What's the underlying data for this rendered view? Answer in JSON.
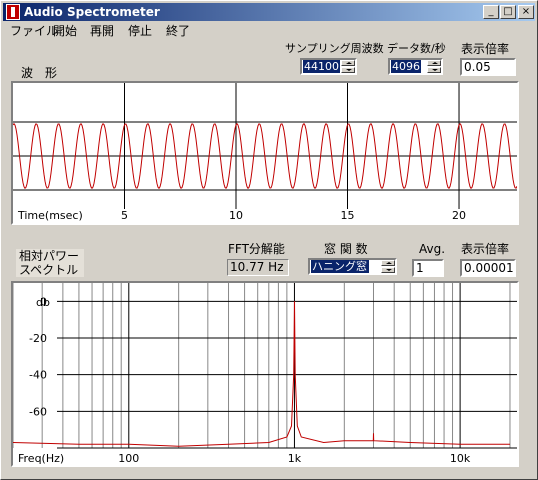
{
  "window": {
    "title": "Audio Spectrometer",
    "min_glyph": "_",
    "max_glyph": "□",
    "close_glyph": "×"
  },
  "menu": [
    "ファイル",
    "開始",
    "再開",
    "停止",
    "終了"
  ],
  "waveform": {
    "label": "波　形",
    "sampling_label": "サンプリング周波数",
    "sampling_value": "44100",
    "data_rate_label": "データ数/秒",
    "data_rate_value": "4096",
    "scale_label": "表示倍率",
    "scale_value": "0.05",
    "axis_label": "Time(msec)",
    "ticks": [
      "5",
      "10",
      "15",
      "20"
    ]
  },
  "spectrum": {
    "label_line1": "相対パワー",
    "label_line2": "スペクトル",
    "fft_label": "FFT分解能",
    "fft_value": "10.77 Hz",
    "window_label": "窓 関 数",
    "window_value": "ハニング窓",
    "avg_label": "Avg.",
    "avg_value": "1",
    "scale_label": "表示倍率",
    "scale_value": "0.00001",
    "unit_label": "db",
    "y_ticks": [
      "0",
      "-20",
      "-40",
      "-60"
    ],
    "x_axis_label": "Freq(Hz)",
    "x_ticks": [
      "100",
      "1k",
      "10k"
    ]
  },
  "colors": {
    "trace": "#c00000",
    "title_from": "#0a246a",
    "title_to": "#a6caf0",
    "face": "#d4d0c8"
  },
  "chart_data": [
    {
      "type": "line",
      "title": "",
      "xlabel": "Time(msec)",
      "ylabel": "",
      "x_ticks": [
        5,
        10,
        15,
        20
      ],
      "xlim": [
        0,
        22.6
      ],
      "series": [
        {
          "frequency_hz": 1000,
          "amplitude": 0.95,
          "values_description_only": null
        }
      ]
    },
    {
      "type": "line",
      "title": "",
      "xlabel": "Freq(Hz)",
      "ylabel": "db",
      "x_scale": "log",
      "xlim": [
        20,
        22050
      ],
      "y_ticks": [
        0,
        -20,
        -40,
        -60
      ],
      "ylim": [
        -80,
        10
      ],
      "series": [
        {
          "x": [
            20,
            50,
            100,
            200,
            400,
            700,
            900,
            960,
            990,
            1000,
            1010,
            1040,
            1100,
            1500,
            2000,
            2990,
            3000,
            3010,
            5000,
            10000,
            20000
          ],
          "y": [
            -77,
            -78,
            -78,
            -79,
            -78,
            -77,
            -74,
            -68,
            -40,
            0,
            -40,
            -68,
            -74,
            -77,
            -76,
            -76,
            -72,
            -76,
            -77,
            -78,
            -78
          ]
        }
      ]
    }
  ]
}
